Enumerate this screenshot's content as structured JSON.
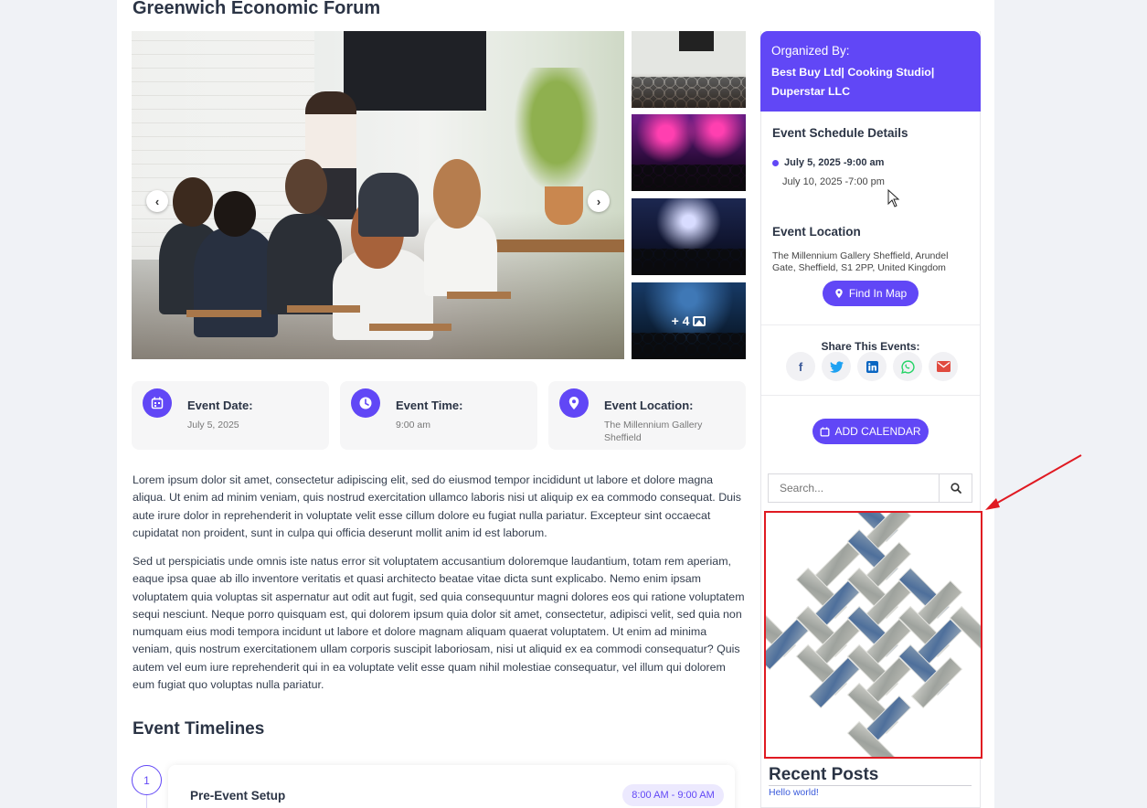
{
  "event": {
    "title": "Greenwich Economic Forum",
    "gallery_more": "+ 4",
    "cards": [
      {
        "label": "Event Date:",
        "value": "July 5, 2025",
        "icon": "calendar-icon"
      },
      {
        "label": "Event Time:",
        "value": "9:00 am",
        "icon": "clock-icon"
      },
      {
        "label": "Event Location:",
        "value": "The Millennium Gallery Sheffield",
        "icon": "location-pin-icon"
      }
    ],
    "paragraphs": [
      "Lorem ipsum dolor sit amet, consectetur adipiscing elit, sed do eiusmod tempor incididunt ut labore et dolore magna aliqua. Ut enim ad minim veniam, quis nostrud exercitation ullamco laboris nisi ut aliquip ex ea commodo consequat. Duis aute irure dolor in reprehenderit in voluptate velit esse cillum dolore eu fugiat nulla pariatur. Excepteur sint occaecat cupidatat non proident, sunt in culpa qui officia deserunt mollit anim id est laborum.",
      "Sed ut perspiciatis unde omnis iste natus error sit voluptatem accusantium doloremque laudantium, totam rem aperiam, eaque ipsa quae ab illo inventore veritatis et quasi architecto beatae vitae dicta sunt explicabo. Nemo enim ipsam voluptatem quia voluptas sit aspernatur aut odit aut fugit, sed quia consequuntur magni dolores eos qui ratione voluptatem sequi nesciunt. Neque porro quisquam est, qui dolorem ipsum quia dolor sit amet, consectetur, adipisci velit, sed quia non numquam eius modi tempora incidunt ut labore et dolore magnam aliquam quaerat voluptatem. Ut enim ad minima veniam, quis nostrum exercitationem ullam corporis suscipit laboriosam, nisi ut aliquid ex ea commodi consequatur? Quis autem vel eum iure reprehenderit qui in ea voluptate velit esse quam nihil molestiae consequatur, vel illum qui dolorem eum fugiat quo voluptas nulla pariatur."
    ],
    "timelines_title": "Event Timelines",
    "timeline": [
      {
        "num": "1",
        "title": "Pre-Event Setup",
        "time": "8:00 AM - 9:00 AM"
      }
    ]
  },
  "sidebar": {
    "organized_label": "Organized By:",
    "organizers": "Best Buy Ltd| Cooking Studio| Duperstar LLC",
    "schedule_title": "Event Schedule Details",
    "schedule_start": "July 5, 2025 -9:00 am",
    "schedule_end": "July 10, 2025 -7:00 pm",
    "location_title": "Event Location",
    "location_address": "The Millennium Gallery Sheffield, Arundel Gate, Sheffield, S1 2PP, United Kingdom",
    "map_button": "Find In Map",
    "share_label": "Share This Events:",
    "share_icons": [
      "facebook-icon",
      "twitter-icon",
      "linkedin-icon",
      "whatsapp-icon",
      "email-icon"
    ],
    "calendar_button": "ADD CALENDAR",
    "search_placeholder": "Search...",
    "recent_title": "Recent Posts",
    "recent_posts": [
      "Hello world!"
    ]
  },
  "colors": {
    "accent": "#6147f6",
    "annotation": "#e01a22"
  }
}
